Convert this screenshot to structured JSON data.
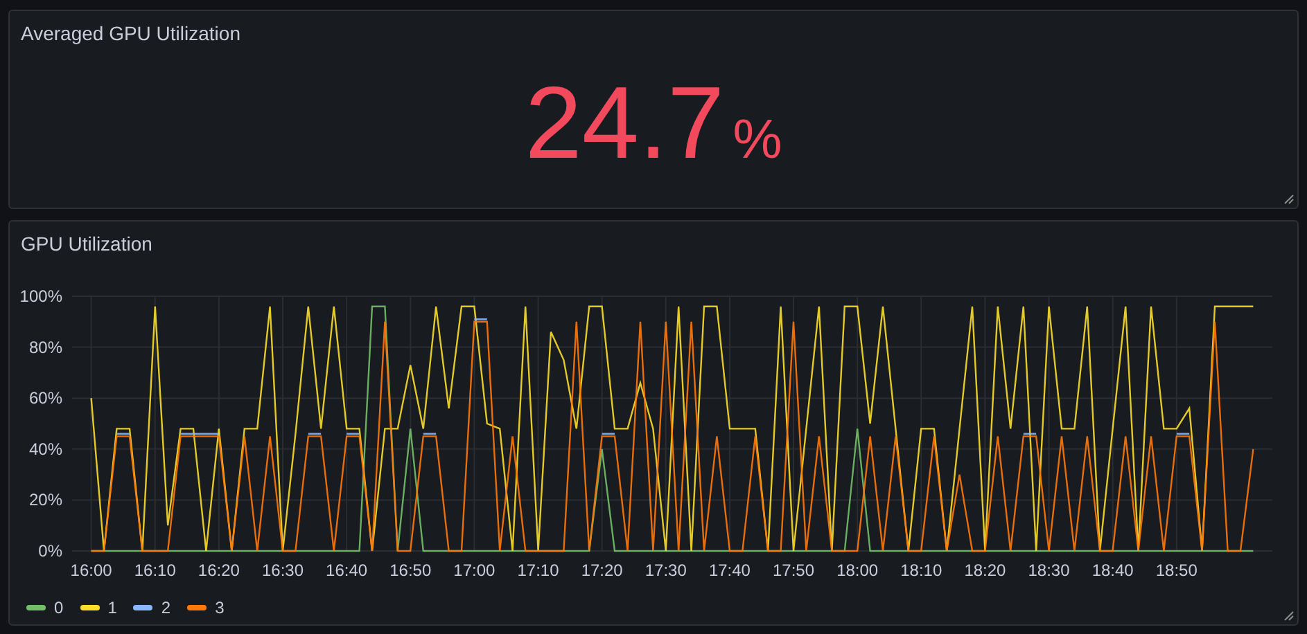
{
  "stat_panel": {
    "title": "Averaged GPU Utilization",
    "value": "24.7",
    "unit": "%"
  },
  "chart_panel": {
    "title": "GPU Utilization",
    "chart_data": {
      "type": "line",
      "categories": [
        "16:00",
        null,
        null,
        null,
        null,
        "16:10",
        null,
        null,
        null,
        null,
        "16:20",
        null,
        null,
        null,
        null,
        "16:30",
        null,
        null,
        null,
        null,
        "16:40",
        null,
        null,
        null,
        null,
        "16:50",
        null,
        null,
        null,
        null,
        "17:00",
        null,
        null,
        null,
        null,
        "17:10",
        null,
        null,
        null,
        null,
        "17:20",
        null,
        null,
        null,
        null,
        "17:30",
        null,
        null,
        null,
        null,
        "17:40",
        null,
        null,
        null,
        null,
        "17:50",
        null,
        null,
        null,
        null,
        "18:00",
        null,
        null,
        null,
        null,
        "18:10",
        null,
        null,
        null,
        null,
        "18:20",
        null,
        null,
        null,
        null,
        "18:30",
        null,
        null,
        null,
        null,
        "18:40",
        null,
        null,
        null,
        null,
        "18:50",
        null,
        null,
        null,
        null,
        null,
        null
      ],
      "ylim": [
        0,
        100
      ],
      "grid": true,
      "yticks": [
        {
          "value": 0,
          "label": "0%"
        },
        {
          "value": 20,
          "label": "20%"
        },
        {
          "value": 40,
          "label": "40%"
        },
        {
          "value": 60,
          "label": "60%"
        },
        {
          "value": 80,
          "label": "80%"
        },
        {
          "value": 100,
          "label": "100%"
        }
      ],
      "series": [
        {
          "name": "0",
          "color": "#73bf69",
          "values": [
            0,
            0,
            0,
            0,
            0,
            0,
            0,
            0,
            0,
            0,
            0,
            0,
            0,
            0,
            0,
            0,
            0,
            0,
            0,
            0,
            0,
            0,
            96,
            96,
            0,
            48,
            0,
            0,
            0,
            0,
            0,
            0,
            0,
            0,
            0,
            0,
            0,
            0,
            0,
            0,
            40,
            0,
            0,
            0,
            0,
            0,
            0,
            0,
            0,
            0,
            0,
            0,
            0,
            0,
            0,
            0,
            0,
            0,
            0,
            0,
            48,
            0,
            0,
            0,
            0,
            0,
            0,
            0,
            0,
            0,
            0,
            0,
            0,
            0,
            0,
            0,
            0,
            0,
            0,
            0,
            0,
            0,
            0,
            0,
            0,
            0,
            0,
            0,
            0,
            0,
            0,
            0
          ]
        },
        {
          "name": "1",
          "color": "#fade2a",
          "values": [
            60,
            0,
            48,
            48,
            0,
            96,
            10,
            48,
            48,
            0,
            48,
            0,
            48,
            48,
            96,
            0,
            46,
            96,
            48,
            96,
            48,
            48,
            0,
            48,
            48,
            73,
            48,
            96,
            56,
            96,
            96,
            50,
            48,
            0,
            96,
            0,
            86,
            75,
            48,
            96,
            96,
            48,
            48,
            66,
            48,
            0,
            96,
            0,
            96,
            96,
            48,
            48,
            48,
            0,
            96,
            0,
            48,
            96,
            0,
            96,
            96,
            50,
            96,
            48,
            0,
            48,
            48,
            0,
            48,
            96,
            0,
            96,
            48,
            96,
            0,
            96,
            48,
            48,
            96,
            0,
            48,
            96,
            0,
            96,
            48,
            48,
            56,
            0,
            96,
            96,
            96,
            96
          ]
        },
        {
          "name": "2",
          "color": "#8ab8ff",
          "values": [
            null,
            null,
            46,
            46,
            null,
            null,
            null,
            46,
            46,
            46,
            46,
            null,
            null,
            null,
            null,
            null,
            null,
            46,
            46,
            null,
            46,
            46,
            null,
            null,
            null,
            null,
            46,
            46,
            null,
            null,
            91,
            91,
            null,
            null,
            null,
            null,
            null,
            null,
            null,
            null,
            46,
            46,
            null,
            null,
            null,
            null,
            null,
            null,
            null,
            null,
            null,
            null,
            null,
            null,
            null,
            null,
            null,
            null,
            null,
            null,
            null,
            null,
            null,
            null,
            null,
            null,
            null,
            null,
            null,
            null,
            null,
            null,
            null,
            46,
            46,
            null,
            null,
            null,
            null,
            null,
            null,
            null,
            null,
            null,
            null,
            46,
            46,
            null,
            null,
            null,
            null,
            null
          ]
        },
        {
          "name": "3",
          "color": "#ff780a",
          "values": [
            0,
            0,
            45,
            45,
            0,
            0,
            0,
            45,
            45,
            45,
            45,
            0,
            45,
            0,
            45,
            0,
            0,
            45,
            45,
            0,
            45,
            45,
            0,
            90,
            0,
            0,
            45,
            45,
            0,
            0,
            90,
            90,
            0,
            45,
            0,
            0,
            0,
            0,
            90,
            0,
            45,
            45,
            0,
            90,
            0,
            90,
            0,
            90,
            0,
            45,
            0,
            0,
            45,
            0,
            0,
            90,
            0,
            45,
            0,
            0,
            0,
            45,
            0,
            45,
            0,
            0,
            45,
            0,
            30,
            0,
            0,
            45,
            0,
            45,
            45,
            0,
            45,
            0,
            45,
            0,
            0,
            45,
            0,
            45,
            0,
            45,
            45,
            0,
            90,
            0,
            0,
            40
          ]
        }
      ]
    }
  }
}
